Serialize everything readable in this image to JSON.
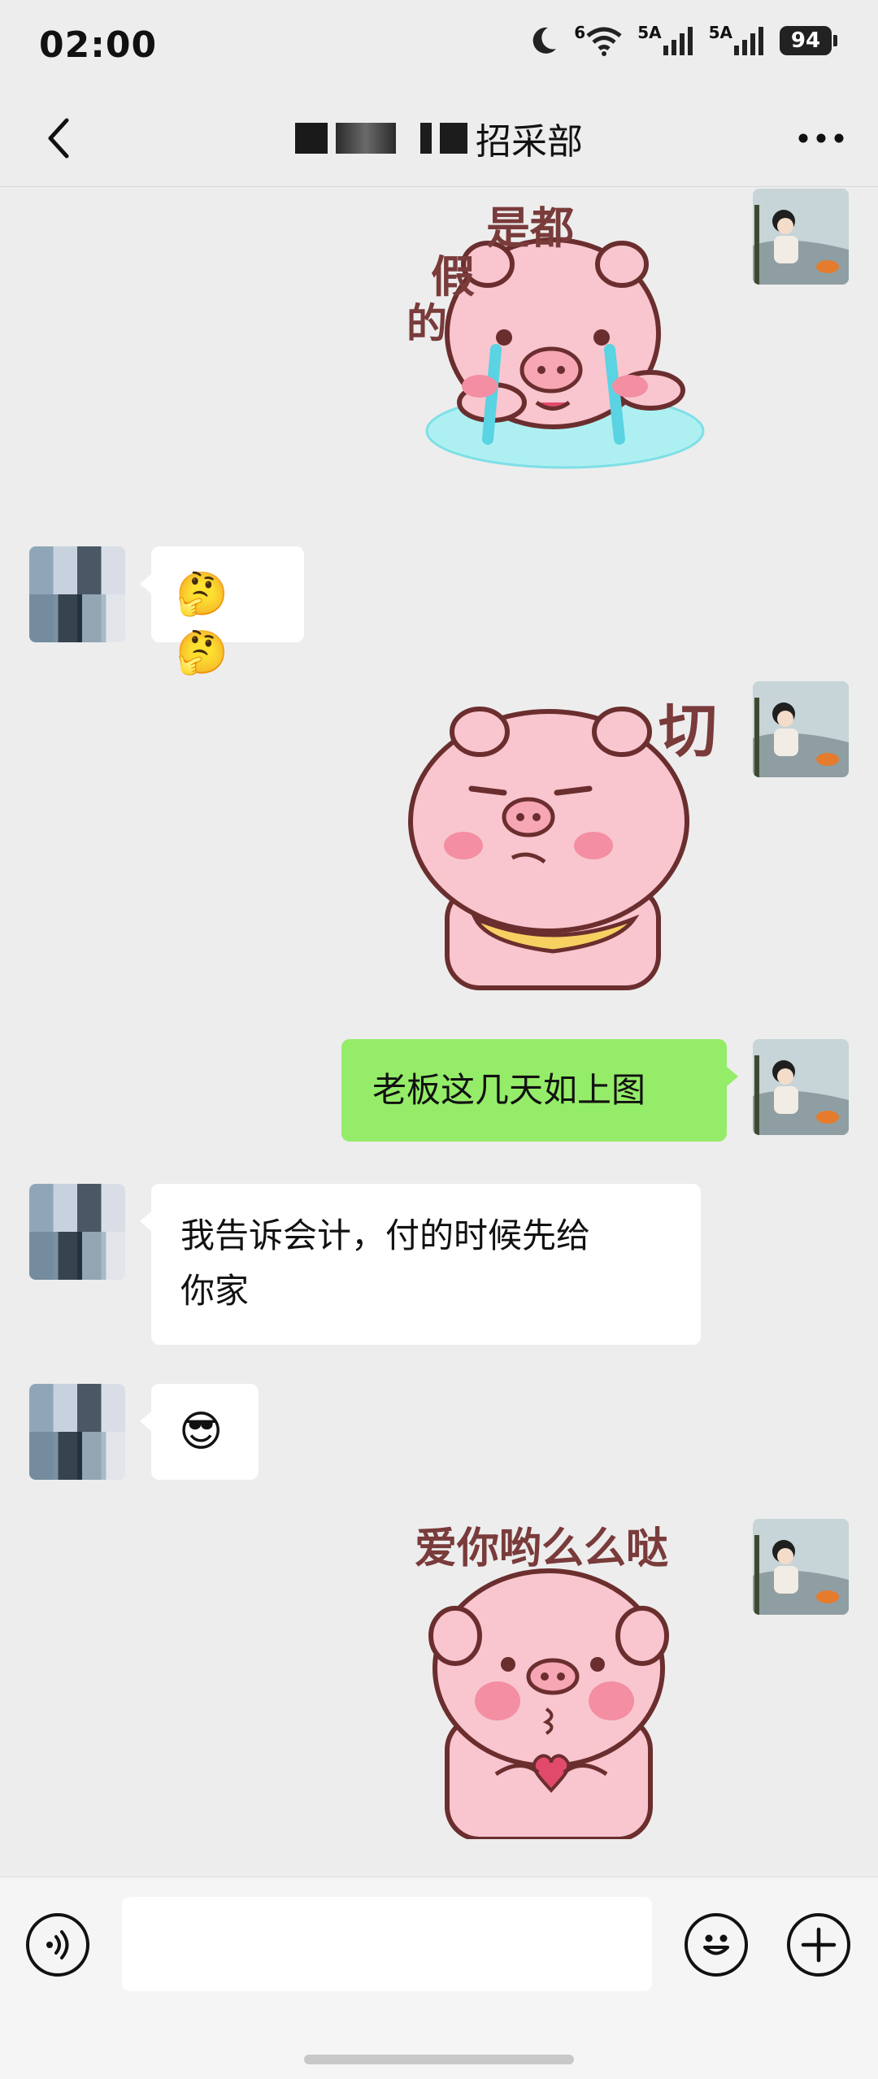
{
  "status_bar": {
    "time": "02:00",
    "network_1": "6",
    "network_2": "5A",
    "network_3": "5A",
    "battery": "94"
  },
  "header": {
    "title_visible": "招采部"
  },
  "messages": [
    {
      "from": "self",
      "type": "sticker",
      "caption": "是都假的"
    },
    {
      "from": "other",
      "type": "text",
      "text": "🤔🤔"
    },
    {
      "from": "self",
      "type": "sticker",
      "caption": "切"
    },
    {
      "from": "self",
      "type": "text",
      "text": "老板这几天如上图"
    },
    {
      "from": "other",
      "type": "text",
      "line1": "我告诉会计，付的时候先给",
      "line2": "你家"
    },
    {
      "from": "other",
      "type": "text",
      "text": "😎"
    },
    {
      "from": "self",
      "type": "sticker",
      "caption": "爱你哟么么哒"
    }
  ],
  "sticker_captions": {
    "s1_a": "是都",
    "s1_b": "假",
    "s1_c": "的",
    "s2": "切",
    "s3": "爱你哟么么哒"
  },
  "input_bar": {
    "placeholder": "",
    "voice_icon": "voice-icon",
    "emoji_icon": "emoji-icon",
    "plus_icon": "plus-icon"
  },
  "colors": {
    "background": "#ededed",
    "bubble_green": "#95ec69",
    "bubble_white": "#ffffff",
    "pig_pink": "#f9c6cf"
  }
}
